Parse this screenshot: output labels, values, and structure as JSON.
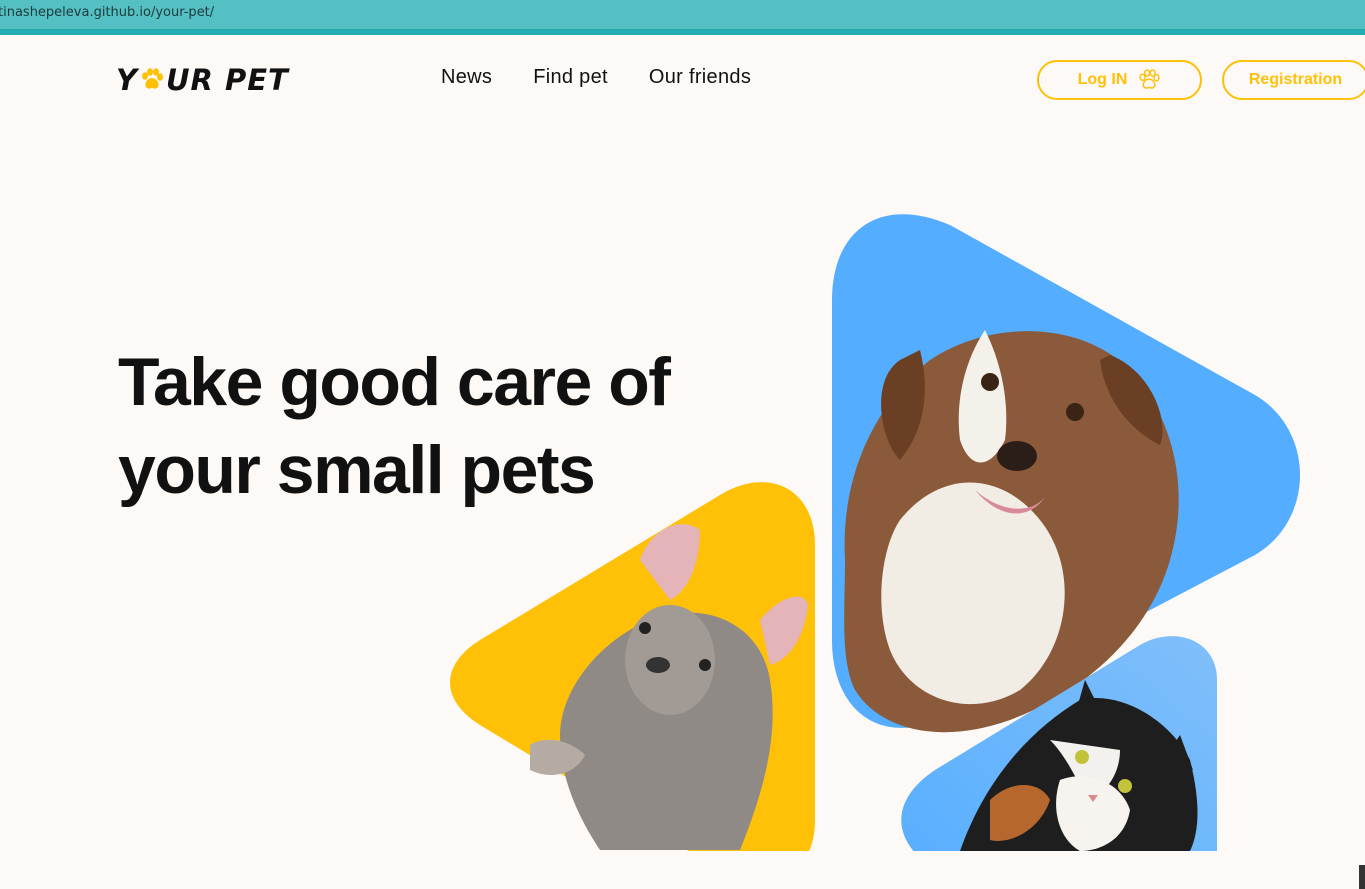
{
  "browser": {
    "url": "tinashepeleva.github.io/your-pet/"
  },
  "header": {
    "logo": {
      "text_left": "Y",
      "text_right": "UR PET",
      "icon": "paw-icon"
    },
    "nav": [
      {
        "label": "News"
      },
      {
        "label": "Find pet"
      },
      {
        "label": "Our friends"
      }
    ],
    "login_label": "Log IN",
    "login_icon": "paw-icon",
    "register_label": "Registration"
  },
  "hero": {
    "title": "Take good care of your small pets",
    "images": [
      "french-bulldog-photo",
      "australian-shepherd-photo",
      "calico-cat-photo"
    ]
  },
  "colors": {
    "accent": "#FFC107",
    "blue": "#54ADFF",
    "background": "#FDF9F7",
    "urlbar": "#54C0C3"
  }
}
